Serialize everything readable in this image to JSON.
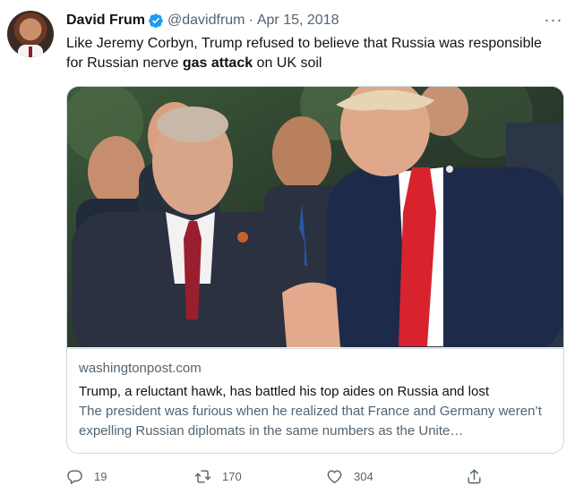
{
  "tweet": {
    "author_name": "David Frum",
    "handle": "@davidfrum",
    "separator": "·",
    "date": "Apr 15, 2018",
    "more_label": "···",
    "text_before": "Like Jeremy Corbyn, Trump refused to believe that Russia was responsible for Russian nerve ",
    "text_bold": "gas attack",
    "text_after": " on UK soil"
  },
  "card": {
    "domain": "washingtonpost.com",
    "headline": "Trump, a reluctant hawk, has battled his top aides on Russia and lost",
    "description": "The president was furious when he realized that France and Germany weren’t expelling Russian diplomats in the same numbers as the Unite…"
  },
  "actions": {
    "reply_count": "19",
    "retweet_count": "170",
    "like_count": "304"
  },
  "colors": {
    "text_primary": "#0f1419",
    "text_secondary": "#536471",
    "verified_blue": "#1d9bf0",
    "border": "#cfd9de"
  },
  "icons": {
    "verified": "verified-badge-icon",
    "reply": "reply-icon",
    "retweet": "retweet-icon",
    "like": "heart-icon",
    "share": "share-icon",
    "more": "more-horizontal-icon"
  }
}
